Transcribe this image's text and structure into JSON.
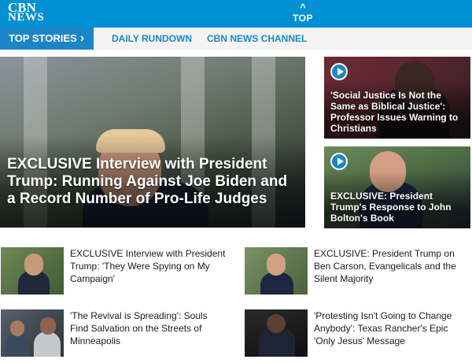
{
  "header": {
    "logo_line1": "CBN",
    "logo_line2": "NEWS",
    "top_chevron": "^",
    "top_label": "TOP",
    "brand_color": "#0090d4"
  },
  "nav": {
    "active_label": "TOP STORIES",
    "active_arrow": "›",
    "links": [
      "DAILY RUNDOWN",
      "CBN NEWS CHANNEL"
    ]
  },
  "hero": {
    "title": "EXCLUSIVE Interview with President Trump: Running Against Joe Biden and a Record Number of Pro-Life Judges"
  },
  "side_stories": [
    {
      "title": "'Social Justice Is Not the Same as Biblical Justice': Professor Issues Warning to Christians",
      "icon": "play-icon"
    },
    {
      "title": "EXCLUSIVE: President Trump's Response to John Bolton's Book",
      "icon": "play-icon"
    }
  ],
  "stories": [
    {
      "title": "EXCLUSIVE Interview with President Trump: 'They Were Spying on My Campaign'"
    },
    {
      "title": "EXCLUSIVE: President Trump on Ben Carson, Evangelicals and the Silent Majority"
    },
    {
      "title": "'The Revival is Spreading': Souls Find Salvation on the Streets of Minneapolis"
    },
    {
      "title": "'Protesting Isn't Going to Change Anybody': Texas Rancher's Epic 'Only Jesus' Message"
    }
  ]
}
